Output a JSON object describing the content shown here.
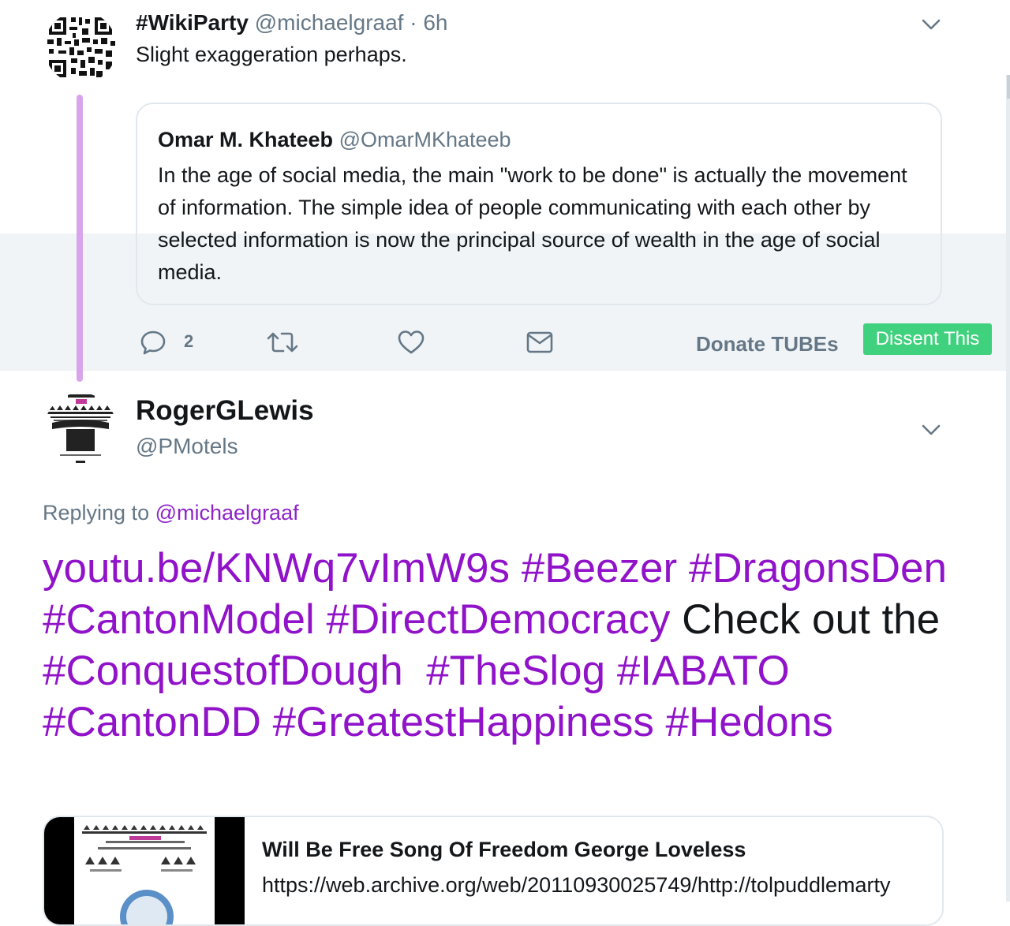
{
  "tweet1": {
    "display_name": "#WikiParty",
    "handle": "@michaelgraaf",
    "separator": "·",
    "time": "6h",
    "text": "Slight exaggeration perhaps."
  },
  "quoted": {
    "display_name": "Omar M. Khateeb",
    "handle": "@OmarMKhateeb",
    "text": "In the age of social media, the main \"work to be done\" is actually the movement of information. The simple idea of people communicating with each other by selected information is now the principal source of wealth in the age of social media."
  },
  "actions": {
    "reply_count": "2",
    "donate_label": "Donate TUBEs",
    "dissent_label": "Dissent This"
  },
  "tweet2": {
    "display_name": "RogerGLewis",
    "handle": "@PMotels",
    "replying_prefix": "Replying to",
    "replying_to": "@michaelgraaf",
    "segments": [
      {
        "text": "youtu.be/KNWq7vImW9s ",
        "link": true
      },
      {
        "text": "#Beezer ",
        "link": true
      },
      {
        "text": "#DragonsDen ",
        "link": true
      },
      {
        "text": "#CantonModel ",
        "link": true
      },
      {
        "text": "#DirectDemocracy",
        "link": true
      },
      {
        "text": " Check out the ",
        "link": false
      },
      {
        "text": "#ConquestofDough",
        "link": true
      },
      {
        "text": "  ",
        "link": false
      },
      {
        "text": "#TheSlog ",
        "link": true
      },
      {
        "text": "#IABATO ",
        "link": true
      },
      {
        "text": "#CantonDD ",
        "link": true
      },
      {
        "text": "#GreatestHappiness ",
        "link": true
      },
      {
        "text": "#Hedons",
        "link": true
      }
    ]
  },
  "card": {
    "title": "Will Be Free Song Of Freedom George Loveless",
    "url": "https://web.archive.org/web/20110930025749/http://tolpuddlemarty"
  },
  "colors": {
    "link": "#9012c9",
    "muted": "#657786",
    "dissent_bg": "#3fd17d",
    "thread_line": "#d8a5ec",
    "hover_band": "#f0f4f6"
  },
  "icons": [
    "caret-down-icon",
    "reply-icon",
    "retweet-icon",
    "like-icon",
    "message-icon"
  ]
}
